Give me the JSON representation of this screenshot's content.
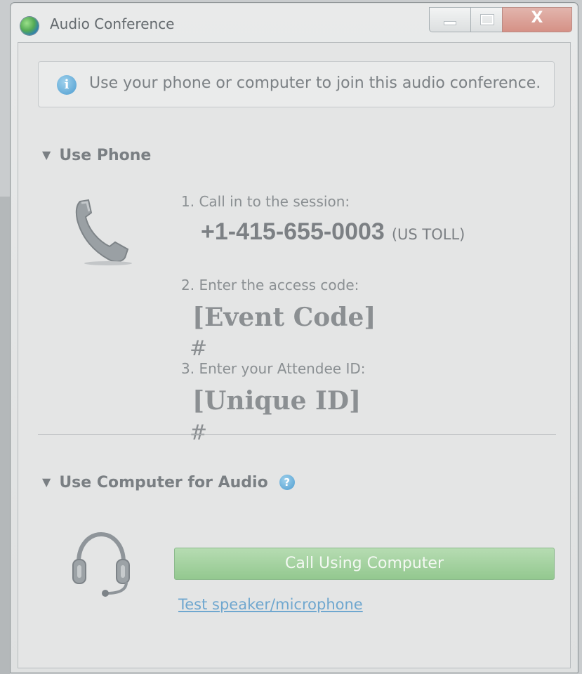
{
  "window": {
    "title": "Audio Conference",
    "close_glyph": "X"
  },
  "info_banner": {
    "icon": "info-icon",
    "text": "Use your phone or computer to join this audio conference."
  },
  "use_phone": {
    "header": "Use Phone",
    "icon": "phone-handset-icon",
    "step1_label": "1. Call in to the session:",
    "phone_number": "+1-415-655-0003",
    "phone_type": "(US TOLL)",
    "step2_label": "2. Enter the access code:",
    "access_code": "[Event Code]",
    "access_code_suffix": "#",
    "step3_label": "3. Enter your Attendee ID:",
    "attendee_id": "[Unique ID]",
    "attendee_id_suffix": "#"
  },
  "use_computer": {
    "header": "Use Computer for Audio",
    "help_icon": "help-icon",
    "icon": "headset-icon",
    "call_button_label": "Call Using Computer",
    "test_link_label": "Test speaker/microphone"
  },
  "colors": {
    "call_button": "#93c88f",
    "link": "#6fa7cf",
    "info_blue": "#4d9cd0"
  }
}
